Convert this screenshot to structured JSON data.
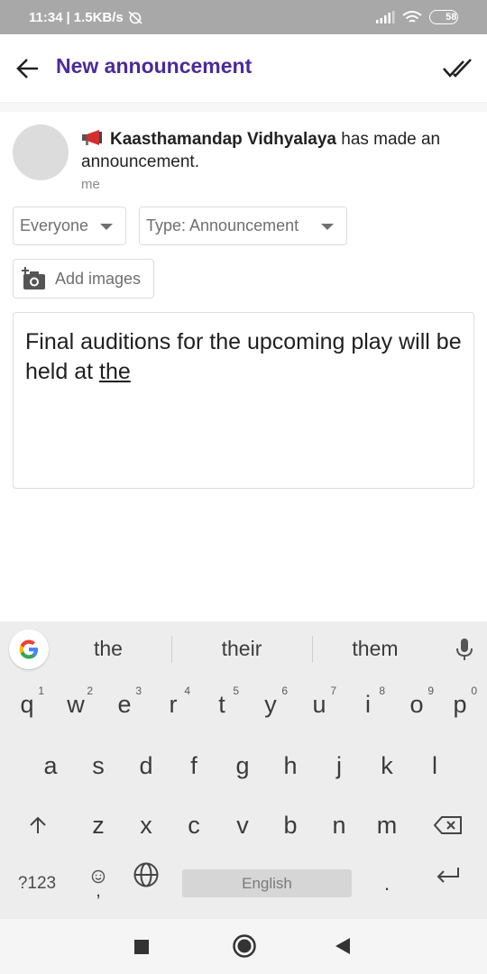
{
  "status_bar": {
    "time": "11:34",
    "speed": "1.5KB/s",
    "battery": "58"
  },
  "app_bar": {
    "title": "New announcement"
  },
  "author": {
    "org_name": "Kaasthamandap Vidhyalaya",
    "action_text": "has made an announcement.",
    "sub_label": "me"
  },
  "controls": {
    "audience_value": "Everyone",
    "type_value": "Type: Announcement",
    "add_images_label": "Add images"
  },
  "composer": {
    "text_main": "Final auditions for the upcoming play will be held at ",
    "text_composing": "the"
  },
  "keyboard": {
    "suggestions": [
      "the",
      "their",
      "them"
    ],
    "row1": [
      {
        "key": "q",
        "hint": "1"
      },
      {
        "key": "w",
        "hint": "2"
      },
      {
        "key": "e",
        "hint": "3"
      },
      {
        "key": "r",
        "hint": "4"
      },
      {
        "key": "t",
        "hint": "5"
      },
      {
        "key": "y",
        "hint": "6"
      },
      {
        "key": "u",
        "hint": "7"
      },
      {
        "key": "i",
        "hint": "8"
      },
      {
        "key": "o",
        "hint": "9"
      },
      {
        "key": "p",
        "hint": "0"
      }
    ],
    "row2": [
      "a",
      "s",
      "d",
      "f",
      "g",
      "h",
      "j",
      "k",
      "l"
    ],
    "row3": [
      "z",
      "x",
      "c",
      "v",
      "b",
      "n",
      "m"
    ],
    "symbols_label": "?123",
    "comma_label": ",",
    "space_label": "English",
    "period_label": "."
  },
  "colors": {
    "accent": "#4b2a9a",
    "status_bar": "#a8a8a8",
    "keyboard_bg": "#ededed"
  }
}
